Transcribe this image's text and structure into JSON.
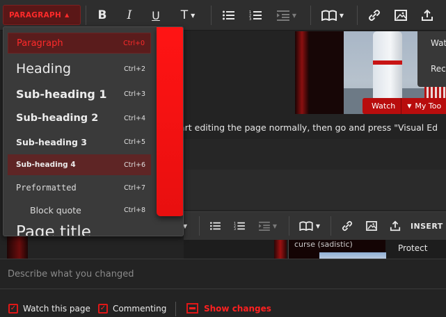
{
  "toolbar": {
    "paragraph_label": "PARAGRAPH",
    "bold": "B",
    "italic": "I",
    "underline": "U",
    "text_style": "T"
  },
  "format_menu": {
    "items": [
      {
        "label": "Paragraph",
        "shortcut": "Ctrl+0"
      },
      {
        "label": "Heading",
        "shortcut": "Ctrl+2"
      },
      {
        "label": "Sub-heading 1",
        "shortcut": "Ctrl+3"
      },
      {
        "label": "Sub-heading 2",
        "shortcut": "Ctrl+4"
      },
      {
        "label": "Sub-heading 3",
        "shortcut": "Ctrl+5"
      },
      {
        "label": "Sub-heading 4",
        "shortcut": "Ctrl+6"
      },
      {
        "label": "Preformatted",
        "shortcut": "Ctrl+7"
      },
      {
        "label": "Block quote",
        "shortcut": "Ctrl+8"
      },
      {
        "label": "Page title",
        "shortcut": ""
      }
    ]
  },
  "page": {
    "watch_label": "Watch",
    "my_tools_label": "My Too",
    "side_menu": [
      "Wat",
      "Rec"
    ],
    "edit_text": "art editing the page normally, then go and press \"Visual Ed",
    "preview_caption": "curse (sadistic)",
    "protect_label": "Protect"
  },
  "toolbar2": {
    "insert_label": "INSERT"
  },
  "summary": {
    "placeholder": "Describe what you changed",
    "value": ""
  },
  "footer": {
    "watch_this_page": "Watch this page",
    "commenting": "Commenting",
    "show_changes": "Show changes"
  },
  "colors": {
    "accent": "#ff1a1a",
    "toolbar_bg": "#2e2e2e",
    "menu_bg": "#3a3a3a",
    "page_bg": "#232323"
  }
}
